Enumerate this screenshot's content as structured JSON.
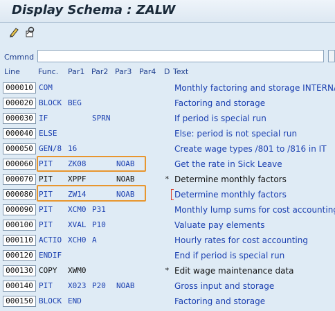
{
  "window": {
    "title": "Display Schema : ZALW"
  },
  "toolbar": {
    "icons": [
      "pencil-glasses-icon",
      "other-object-icon"
    ]
  },
  "command": {
    "label": "Cmmnd",
    "value": ""
  },
  "columns": {
    "line": "Line",
    "func": "Func.",
    "par1": "Par1",
    "par2": "Par2",
    "par3": "Par3",
    "par4": "Par4",
    "d": "D",
    "text": "Text"
  },
  "colors": {
    "blue": "#1a3fb0",
    "black": "#111111",
    "highlight": "#e8962e"
  },
  "rows": [
    {
      "line": "000010",
      "func": "COM",
      "par1": "",
      "par2": "",
      "par3": "",
      "par4": "",
      "d": "",
      "text": "Monthly factoring and storage INTERNAT.",
      "color": "blue"
    },
    {
      "line": "000020",
      "func": "BLOCK",
      "par1": "BEG",
      "par2": "",
      "par3": "",
      "par4": "",
      "d": "",
      "text": "Factoring and storage",
      "color": "blue"
    },
    {
      "line": "000030",
      "func": "IF",
      "par1": "",
      "par2": "SPRN",
      "par3": "",
      "par4": "",
      "d": "",
      "text": "If period is special run",
      "color": "blue"
    },
    {
      "line": "000040",
      "func": "ELSE",
      "par1": "",
      "par2": "",
      "par3": "",
      "par4": "",
      "d": "",
      "text": "Else: period is not special run",
      "color": "blue"
    },
    {
      "line": "000050",
      "func": "GEN/8",
      "par1": "16",
      "par2": "",
      "par3": "",
      "par4": "",
      "d": "",
      "text": "Create wage types /801 to /816 in IT",
      "color": "blue"
    },
    {
      "line": "000060",
      "func": "PIT",
      "par1": "ZK08",
      "par2": "",
      "par3": "NOAB",
      "par4": "",
      "d": "",
      "text": "Get the rate in Sick Leave",
      "color": "blue"
    },
    {
      "line": "000070",
      "func": "PIT",
      "par1": "XPPF",
      "par2": "",
      "par3": "NOAB",
      "par4": "",
      "d": "*",
      "text": "Determine monthly factors",
      "color": "black"
    },
    {
      "line": "000080",
      "func": "PIT",
      "par1": "ZW14",
      "par2": "",
      "par3": "NOAB",
      "par4": "",
      "d": "",
      "text": "Determine monthly factors",
      "color": "blue"
    },
    {
      "line": "000090",
      "func": "PIT",
      "par1": "XCM0",
      "par2": "P31",
      "par3": "",
      "par4": "",
      "d": "",
      "text": "Monthly lump sums for cost accounting",
      "color": "blue"
    },
    {
      "line": "000100",
      "func": "PIT",
      "par1": "XVAL",
      "par2": "P10",
      "par3": "",
      "par4": "",
      "d": "",
      "text": "Valuate pay elements",
      "color": "blue"
    },
    {
      "line": "000110",
      "func": "ACTIO",
      "par1": "XCH0",
      "par2": "A",
      "par3": "",
      "par4": "",
      "d": "",
      "text": "Hourly rates for cost accounting",
      "color": "blue"
    },
    {
      "line": "000120",
      "func": "ENDIF",
      "par1": "",
      "par2": "",
      "par3": "",
      "par4": "",
      "d": "",
      "text": "End if period is special run",
      "color": "blue"
    },
    {
      "line": "000130",
      "func": "COPY",
      "par1": "XWM0",
      "par2": "",
      "par3": "",
      "par4": "",
      "d": "*",
      "text": "Edit wage maintenance data",
      "color": "black"
    },
    {
      "line": "000140",
      "func": "PIT",
      "par1": "X023",
      "par2": "P20",
      "par3": "NOAB",
      "par4": "",
      "d": "",
      "text": "Gross input and storage",
      "color": "blue"
    },
    {
      "line": "000150",
      "func": "BLOCK",
      "par1": "END",
      "par2": "",
      "par3": "",
      "par4": "",
      "d": "",
      "text": "Factoring and storage",
      "color": "blue"
    }
  ]
}
